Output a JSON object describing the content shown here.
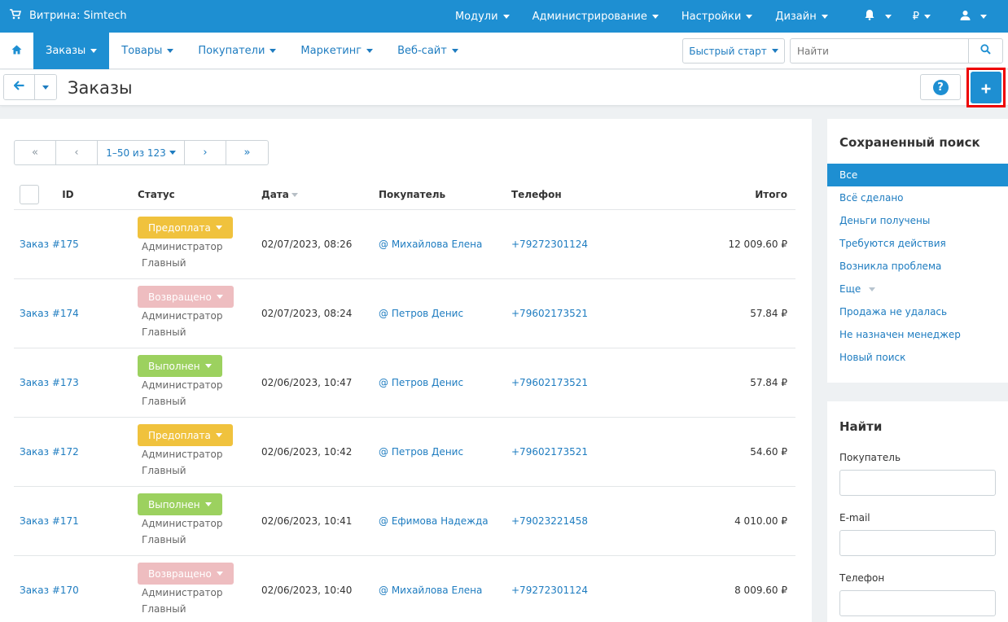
{
  "topbar": {
    "store_label": "Витрина: Simtech",
    "menu": [
      "Модули",
      "Администрирование",
      "Настройки",
      "Дизайн"
    ],
    "currency": "₽"
  },
  "navbar": {
    "tabs": [
      "Заказы",
      "Товары",
      "Покупатели",
      "Маркетинг",
      "Веб-сайт"
    ],
    "quick_start": "Быстрый старт",
    "search_placeholder": "Найти"
  },
  "titlebar": {
    "title": "Заказы"
  },
  "pager": {
    "first": "«",
    "prev": "‹",
    "range": "1–50 из 123",
    "next": "›",
    "last": "»"
  },
  "table": {
    "headers": {
      "id": "ID",
      "status": "Статус",
      "date": "Дата",
      "customer": "Покупатель",
      "phone": "Телефон",
      "total": "Итого"
    },
    "rows": [
      {
        "order": "Заказ #175",
        "status": "Предоплата",
        "status_color": "#f0c23d",
        "manager1": "Администратор",
        "manager2": "Главный",
        "date": "02/07/2023, 08:26",
        "customer": "@ Михайлова Елена",
        "phone": "+79272301124",
        "total": "12 009.60 ₽"
      },
      {
        "order": "Заказ #174",
        "status": "Возвращено",
        "status_color": "#eebdc0",
        "manager1": "Администратор",
        "manager2": "Главный",
        "date": "02/07/2023, 08:24",
        "customer": "@ Петров Денис",
        "phone": "+79602173521",
        "total": "57.84 ₽"
      },
      {
        "order": "Заказ #173",
        "status": "Выполнен",
        "status_color": "#9cd15f",
        "manager1": "Администратор",
        "manager2": "Главный",
        "date": "02/06/2023, 10:47",
        "customer": "@ Петров Денис",
        "phone": "+79602173521",
        "total": "57.84 ₽"
      },
      {
        "order": "Заказ #172",
        "status": "Предоплата",
        "status_color": "#f0c23d",
        "manager1": "Администратор",
        "manager2": "Главный",
        "date": "02/06/2023, 10:42",
        "customer": "@ Петров Денис",
        "phone": "+79602173521",
        "total": "54.60 ₽"
      },
      {
        "order": "Заказ #171",
        "status": "Выполнен",
        "status_color": "#9cd15f",
        "manager1": "Администратор",
        "manager2": "Главный",
        "date": "02/06/2023, 10:41",
        "customer": "@ Ефимова Надежда",
        "phone": "+79023221458",
        "total": "4 010.00 ₽"
      },
      {
        "order": "Заказ #170",
        "status": "Возвращено",
        "status_color": "#eebdc0",
        "manager1": "Администратор",
        "manager2": "Главный",
        "date": "02/06/2023, 10:40",
        "customer": "@ Михайлова Елена",
        "phone": "+79272301124",
        "total": "8 009.60 ₽"
      }
    ]
  },
  "saved_search": {
    "title": "Сохраненный поиск",
    "items": [
      "Все",
      "Всё сделано",
      "Деньги получены",
      "Требуются действия",
      "Возникла проблема",
      "Еще",
      "Продажа не удалась",
      "Не назначен менеджер",
      "Новый поиск"
    ]
  },
  "find": {
    "title": "Найти",
    "customer_label": "Покупатель",
    "email_label": "E-mail",
    "phone_label": "Телефон"
  },
  "colors": {
    "accent": "#1e8fd2",
    "link": "#1e7cc0",
    "highlight_border": "#ee0000"
  }
}
